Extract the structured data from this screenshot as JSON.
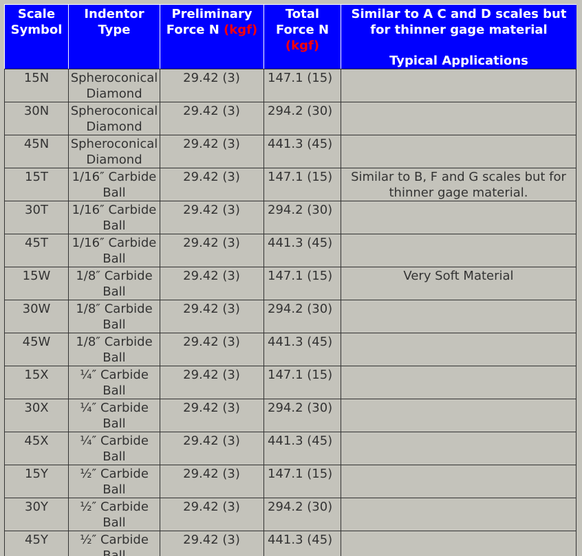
{
  "headers": {
    "scale": "Scale Symbol",
    "indentor": "Indentor Type",
    "preliminary_main": "Preliminary Force N ",
    "preliminary_unit": "(kgf)",
    "total_main": "Total Force N",
    "total_unit": "(kgf)",
    "applications_note": "Similar to A C and D scales but for thinner gage material",
    "applications_title": "Typical Applications"
  },
  "colors": {
    "header_background": "#0000ff",
    "header_text": "#ffffff",
    "unit_text": "#ff0000",
    "body_background": "#c4c3bb"
  },
  "rows": [
    {
      "scale": "15N",
      "indentor": "Spheroconical Diamond",
      "preliminary": "29.42 (3)",
      "total": "147.1 (15)",
      "application": ""
    },
    {
      "scale": "30N",
      "indentor": "Spheroconical Diamond",
      "preliminary": "29.42 (3)",
      "total": "294.2 (30)",
      "application": ""
    },
    {
      "scale": "45N",
      "indentor": "Spheroconical Diamond",
      "preliminary": "29.42 (3)",
      "total": "441.3 (45)",
      "application": ""
    },
    {
      "scale": "15T",
      "indentor": "1/16″ Carbide Ball",
      "preliminary": "29.42 (3)",
      "total": "147.1 (15)",
      "application": "Similar to B, F and G scales but for thinner gage material."
    },
    {
      "scale": "30T",
      "indentor": "1/16″ Carbide Ball",
      "preliminary": "29.42 (3)",
      "total": "294.2 (30)",
      "application": ""
    },
    {
      "scale": "45T",
      "indentor": "1/16″ Carbide Ball",
      "preliminary": "29.42 (3)",
      "total": "441.3 (45)",
      "application": ""
    },
    {
      "scale": "15W",
      "indentor": "1/8″ Carbide Ball",
      "preliminary": "29.42 (3)",
      "total": "147.1 (15)",
      "application": "Very Soft Material"
    },
    {
      "scale": "30W",
      "indentor": "1/8″ Carbide Ball",
      "preliminary": "29.42 (3)",
      "total": "294.2 (30)",
      "application": ""
    },
    {
      "scale": "45W",
      "indentor": "1/8″ Carbide Ball",
      "preliminary": "29.42 (3)",
      "total": "441.3 (45)",
      "application": ""
    },
    {
      "scale": "15X",
      "indentor": "¼″ Carbide Ball",
      "preliminary": "29.42 (3)",
      "total": "147.1 (15)",
      "application": ""
    },
    {
      "scale": "30X",
      "indentor": "¼″ Carbide Ball",
      "preliminary": "29.42 (3)",
      "total": "294.2 (30)",
      "application": ""
    },
    {
      "scale": "45X",
      "indentor": "¼″ Carbide Ball",
      "preliminary": "29.42 (3)",
      "total": "441.3 (45)",
      "application": ""
    },
    {
      "scale": "15Y",
      "indentor": "½″ Carbide Ball",
      "preliminary": "29.42 (3)",
      "total": "147.1 (15)",
      "application": ""
    },
    {
      "scale": "30Y",
      "indentor": "½″ Carbide Ball",
      "preliminary": "29.42 (3)",
      "total": "294.2 (30)",
      "application": ""
    },
    {
      "scale": "45Y",
      "indentor": "½″ Carbide Ball",
      "preliminary": "29.42 (3)",
      "total": "441.3 (45)",
      "application": ""
    }
  ]
}
